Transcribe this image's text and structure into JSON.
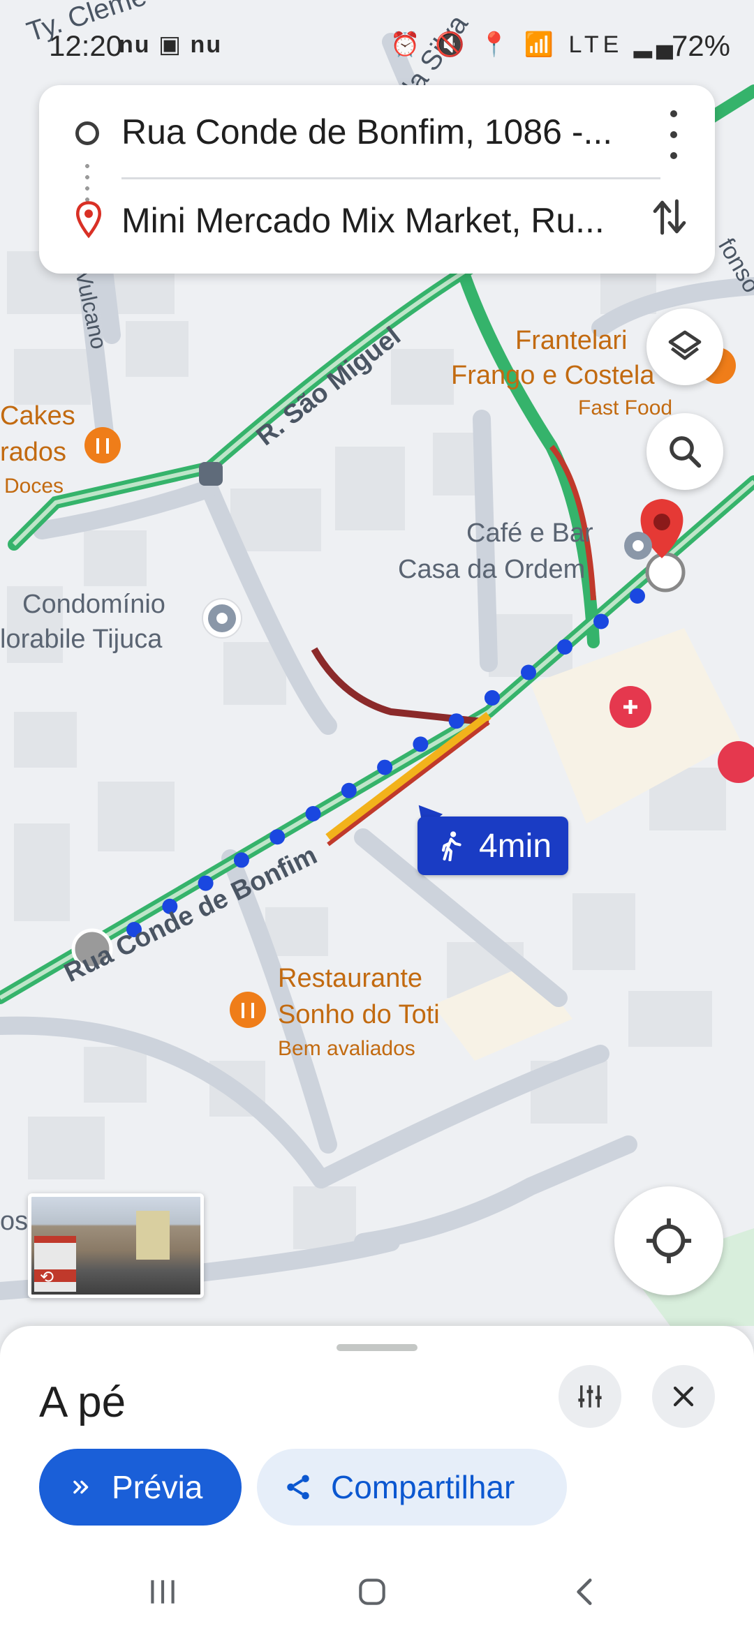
{
  "status_bar": {
    "time": "12:20",
    "left_icons": "nu ▣ nu",
    "right_icons": "⏰ 🔇 📍 📶 LTE ▂▄",
    "battery": "72%"
  },
  "route": {
    "origin": "Rua Conde de Bonfim, 1086 -...",
    "destination": "Mini Mercado Mix Market, Ru..."
  },
  "map": {
    "labels": {
      "street_sao_miguel": "R. São Miguel",
      "street_conde": "Rua Conde de Bonfim",
      "street_vulcano": "Vulcano",
      "street_silva": "da Silva",
      "street_afonso": "fonso",
      "top_left_fragment": "Ty. Cleme",
      "cakes_1": "Cakes",
      "cakes_2": "rados",
      "cakes_3": "Doces",
      "condominio_1": "Condomínio",
      "condominio_2": "lorabile Tijuca",
      "frangolari_1": "Frantelari",
      "frangolari_2": "Frango e Costela",
      "fast_food": "Fast Food",
      "cafe_1": "Café e Bar",
      "cafe_2": "Casa da Ordem",
      "restaurante_1": "Restaurante",
      "restaurante_2": "Sonho do Toti",
      "bem_avaliados": "Bem avaliados",
      "os_fragment": "os"
    },
    "walk_time": "4min",
    "colors": {
      "walk_dots": "#1a47e0",
      "green_road": "#35b36b",
      "traffic_red": "#8b2a2a",
      "traffic_orange": "#f2b21b",
      "pin_red": "#d32f2f",
      "restaurant_orange": "#ef7d19"
    }
  },
  "sheet": {
    "mode_title": "A pé",
    "preview_label": "Prévia",
    "share_label": "Compartilhar"
  },
  "icons": {
    "layers": "layers-icon",
    "search": "search-icon",
    "locate": "my-location-icon",
    "walk": "walking-person-icon",
    "options": "tune-icon",
    "close": "close-icon",
    "preview": "double-chevron-icon",
    "share": "share-icon",
    "more": "more-vert-icon",
    "swap": "swap-vert-icon"
  }
}
